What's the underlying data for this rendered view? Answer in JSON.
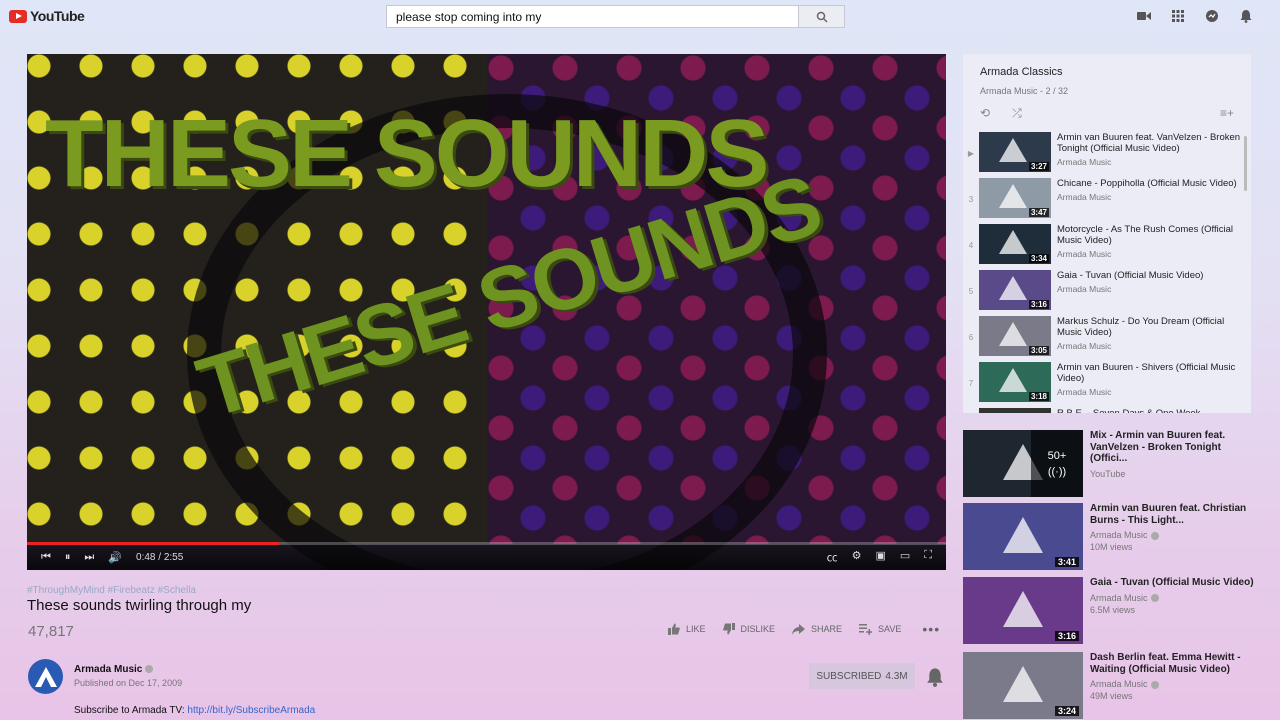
{
  "header": {
    "logo_text": "YouTube",
    "search_value": "please stop coming into my"
  },
  "player": {
    "overlay_text_1": "THESE SOUNDS",
    "overlay_text_2": "THESE SOUNDS",
    "time": "0:48 / 2:55",
    "progress": 0.274
  },
  "video": {
    "tags": "#ThroughMyMind #Firebeatz #Schella",
    "title": "These sounds twirling through my",
    "views": "47,817",
    "actions": {
      "like": "LIKE",
      "dislike": "DISLIKE",
      "share": "SHARE",
      "save": "SAVE"
    },
    "channel": {
      "name": "Armada Music",
      "published": "Published on Dec 17, 2009",
      "subscribe_text": "Subscribe to Armada TV:",
      "subscribe_link": "http://bit.ly/SubscribeArmada",
      "subscribed_label": "SUBSCRIBED",
      "subscriber_count": "4.3M"
    }
  },
  "playlist": {
    "title": "Armada Classics",
    "owner": "Armada Music",
    "position": "2 / 32",
    "items": [
      {
        "index": "▶",
        "title": "Armin van Buuren feat. VanVelzen - Broken Tonight (Official Music Video)",
        "channel": "Armada Music",
        "duration": "3:27"
      },
      {
        "index": "3",
        "title": "Chicane - Poppiholla (Official Music Video)",
        "channel": "Armada Music",
        "duration": "3:47"
      },
      {
        "index": "4",
        "title": "Motorcycle - As The Rush Comes (Official Music Video)",
        "channel": "Armada Music",
        "duration": "3:34"
      },
      {
        "index": "5",
        "title": "Gaia - Tuvan (Official Music Video)",
        "channel": "Armada Music",
        "duration": "3:16"
      },
      {
        "index": "6",
        "title": "Markus Schulz - Do You Dream (Official Music Video)",
        "channel": "Armada Music",
        "duration": "3:05"
      },
      {
        "index": "7",
        "title": "Armin van Buuren - Shivers (Official Music Video)",
        "channel": "Armada Music",
        "duration": "3:18"
      },
      {
        "index": "",
        "title": "R.B.E. - Seven Days & One Week",
        "channel": "",
        "duration": ""
      }
    ]
  },
  "recommendations": [
    {
      "title": "Mix - Armin van Buuren feat. VanVelzen - Broken Tonight (Offici...",
      "channel": "YouTube",
      "views": "",
      "duration": "",
      "mix_count": "50+"
    },
    {
      "title": "Armin van Buuren feat. Christian Burns - This Light...",
      "channel": "Armada Music",
      "views": "10M views",
      "duration": "3:41"
    },
    {
      "title": "Gaia - Tuvan (Official Music Video)",
      "channel": "Armada Music",
      "views": "6.5M views",
      "duration": "3:16"
    },
    {
      "title": "Dash Berlin feat. Emma Hewitt - Waiting (Official Music Video)",
      "channel": "Armada Music",
      "views": "49M views",
      "duration": "3:24"
    }
  ]
}
